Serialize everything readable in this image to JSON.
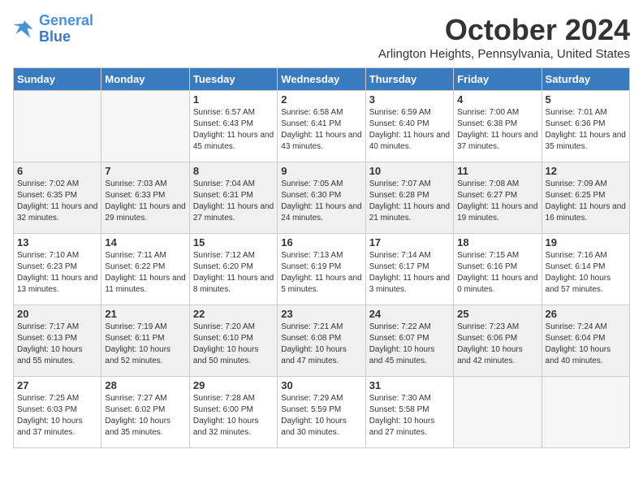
{
  "header": {
    "logo_line1": "General",
    "logo_line2": "Blue",
    "month_title": "October 2024",
    "location": "Arlington Heights, Pennsylvania, United States"
  },
  "days_of_week": [
    "Sunday",
    "Monday",
    "Tuesday",
    "Wednesday",
    "Thursday",
    "Friday",
    "Saturday"
  ],
  "weeks": [
    [
      {
        "day": "",
        "info": ""
      },
      {
        "day": "",
        "info": ""
      },
      {
        "day": "1",
        "info": "Sunrise: 6:57 AM\nSunset: 6:43 PM\nDaylight: 11 hours and 45 minutes."
      },
      {
        "day": "2",
        "info": "Sunrise: 6:58 AM\nSunset: 6:41 PM\nDaylight: 11 hours and 43 minutes."
      },
      {
        "day": "3",
        "info": "Sunrise: 6:59 AM\nSunset: 6:40 PM\nDaylight: 11 hours and 40 minutes."
      },
      {
        "day": "4",
        "info": "Sunrise: 7:00 AM\nSunset: 6:38 PM\nDaylight: 11 hours and 37 minutes."
      },
      {
        "day": "5",
        "info": "Sunrise: 7:01 AM\nSunset: 6:36 PM\nDaylight: 11 hours and 35 minutes."
      }
    ],
    [
      {
        "day": "6",
        "info": "Sunrise: 7:02 AM\nSunset: 6:35 PM\nDaylight: 11 hours and 32 minutes."
      },
      {
        "day": "7",
        "info": "Sunrise: 7:03 AM\nSunset: 6:33 PM\nDaylight: 11 hours and 29 minutes."
      },
      {
        "day": "8",
        "info": "Sunrise: 7:04 AM\nSunset: 6:31 PM\nDaylight: 11 hours and 27 minutes."
      },
      {
        "day": "9",
        "info": "Sunrise: 7:05 AM\nSunset: 6:30 PM\nDaylight: 11 hours and 24 minutes."
      },
      {
        "day": "10",
        "info": "Sunrise: 7:07 AM\nSunset: 6:28 PM\nDaylight: 11 hours and 21 minutes."
      },
      {
        "day": "11",
        "info": "Sunrise: 7:08 AM\nSunset: 6:27 PM\nDaylight: 11 hours and 19 minutes."
      },
      {
        "day": "12",
        "info": "Sunrise: 7:09 AM\nSunset: 6:25 PM\nDaylight: 11 hours and 16 minutes."
      }
    ],
    [
      {
        "day": "13",
        "info": "Sunrise: 7:10 AM\nSunset: 6:23 PM\nDaylight: 11 hours and 13 minutes."
      },
      {
        "day": "14",
        "info": "Sunrise: 7:11 AM\nSunset: 6:22 PM\nDaylight: 11 hours and 11 minutes."
      },
      {
        "day": "15",
        "info": "Sunrise: 7:12 AM\nSunset: 6:20 PM\nDaylight: 11 hours and 8 minutes."
      },
      {
        "day": "16",
        "info": "Sunrise: 7:13 AM\nSunset: 6:19 PM\nDaylight: 11 hours and 5 minutes."
      },
      {
        "day": "17",
        "info": "Sunrise: 7:14 AM\nSunset: 6:17 PM\nDaylight: 11 hours and 3 minutes."
      },
      {
        "day": "18",
        "info": "Sunrise: 7:15 AM\nSunset: 6:16 PM\nDaylight: 11 hours and 0 minutes."
      },
      {
        "day": "19",
        "info": "Sunrise: 7:16 AM\nSunset: 6:14 PM\nDaylight: 10 hours and 57 minutes."
      }
    ],
    [
      {
        "day": "20",
        "info": "Sunrise: 7:17 AM\nSunset: 6:13 PM\nDaylight: 10 hours and 55 minutes."
      },
      {
        "day": "21",
        "info": "Sunrise: 7:19 AM\nSunset: 6:11 PM\nDaylight: 10 hours and 52 minutes."
      },
      {
        "day": "22",
        "info": "Sunrise: 7:20 AM\nSunset: 6:10 PM\nDaylight: 10 hours and 50 minutes."
      },
      {
        "day": "23",
        "info": "Sunrise: 7:21 AM\nSunset: 6:08 PM\nDaylight: 10 hours and 47 minutes."
      },
      {
        "day": "24",
        "info": "Sunrise: 7:22 AM\nSunset: 6:07 PM\nDaylight: 10 hours and 45 minutes."
      },
      {
        "day": "25",
        "info": "Sunrise: 7:23 AM\nSunset: 6:06 PM\nDaylight: 10 hours and 42 minutes."
      },
      {
        "day": "26",
        "info": "Sunrise: 7:24 AM\nSunset: 6:04 PM\nDaylight: 10 hours and 40 minutes."
      }
    ],
    [
      {
        "day": "27",
        "info": "Sunrise: 7:25 AM\nSunset: 6:03 PM\nDaylight: 10 hours and 37 minutes."
      },
      {
        "day": "28",
        "info": "Sunrise: 7:27 AM\nSunset: 6:02 PM\nDaylight: 10 hours and 35 minutes."
      },
      {
        "day": "29",
        "info": "Sunrise: 7:28 AM\nSunset: 6:00 PM\nDaylight: 10 hours and 32 minutes."
      },
      {
        "day": "30",
        "info": "Sunrise: 7:29 AM\nSunset: 5:59 PM\nDaylight: 10 hours and 30 minutes."
      },
      {
        "day": "31",
        "info": "Sunrise: 7:30 AM\nSunset: 5:58 PM\nDaylight: 10 hours and 27 minutes."
      },
      {
        "day": "",
        "info": ""
      },
      {
        "day": "",
        "info": ""
      }
    ]
  ]
}
